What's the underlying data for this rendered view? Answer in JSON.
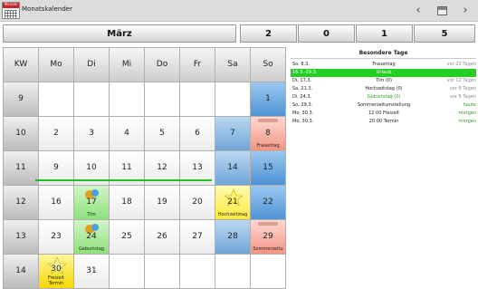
{
  "app": {
    "icon_label": "Monats",
    "title": "Monatskalender"
  },
  "header": {
    "month": "März",
    "counts": [
      "2",
      "0",
      "1",
      "5"
    ]
  },
  "calendar": {
    "columns": [
      "KW",
      "Mo",
      "Di",
      "Mi",
      "Do",
      "Fr",
      "Sa",
      "So"
    ],
    "weeks": [
      {
        "kw": "9",
        "days": [
          "",
          "",
          "",
          "",
          "",
          "",
          "1"
        ]
      },
      {
        "kw": "10",
        "days": [
          "2",
          "3",
          "4",
          "5",
          "6",
          "7",
          "8"
        ]
      },
      {
        "kw": "11",
        "days": [
          "9",
          "10",
          "11",
          "12",
          "13",
          "14",
          "15"
        ]
      },
      {
        "kw": "12",
        "days": [
          "16",
          "17",
          "18",
          "19",
          "20",
          "21",
          "22"
        ]
      },
      {
        "kw": "13",
        "days": [
          "23",
          "24",
          "25",
          "26",
          "27",
          "28",
          "29"
        ]
      },
      {
        "kw": "14",
        "days": [
          "30",
          "31",
          "",
          "",
          "",
          "",
          ""
        ]
      }
    ],
    "labels": {
      "frauentag": "Frauentag",
      "tim": "Tim",
      "hochzeitstag": "Hochzeitstag",
      "geburtstag": "Geburtstag",
      "sommerzeit": "Sommerzeitu",
      "freizeit": "Freizeit",
      "termin": "Termin"
    }
  },
  "special_days": {
    "title": "Besondere Tage",
    "rows": [
      {
        "date": "So, 8.3.",
        "event": "Frauentag",
        "rel": "vor 21 Tagen"
      },
      {
        "date": "16.3.-19.3.",
        "event": "Urlaub",
        "rel": ""
      },
      {
        "date": "Di, 17.3.",
        "event": "Tim (0)",
        "rel": "vor 12 Tagen"
      },
      {
        "date": "Sa, 21.3.",
        "event": "Hochzeitstag (0)",
        "rel": "vor 8 Tagen"
      },
      {
        "date": "Di, 24.3.",
        "event": "Geburtstag (0)",
        "rel": "vor 5 Tagen"
      },
      {
        "date": "So, 29.3.",
        "event": "Sommerzeitumstellung",
        "rel": "heute"
      },
      {
        "date": "Mo, 30.3.",
        "event": "12:00 Freizeit",
        "rel": "morgen"
      },
      {
        "date": "Mo, 30.3.",
        "event": "20:00 Termin",
        "rel": "morgen"
      }
    ]
  },
  "colors": {
    "accent_green": "#22d022",
    "weekend_blue": "#4d93d6",
    "today_yellow": "#f7d800",
    "event_pink": "#f49483"
  }
}
